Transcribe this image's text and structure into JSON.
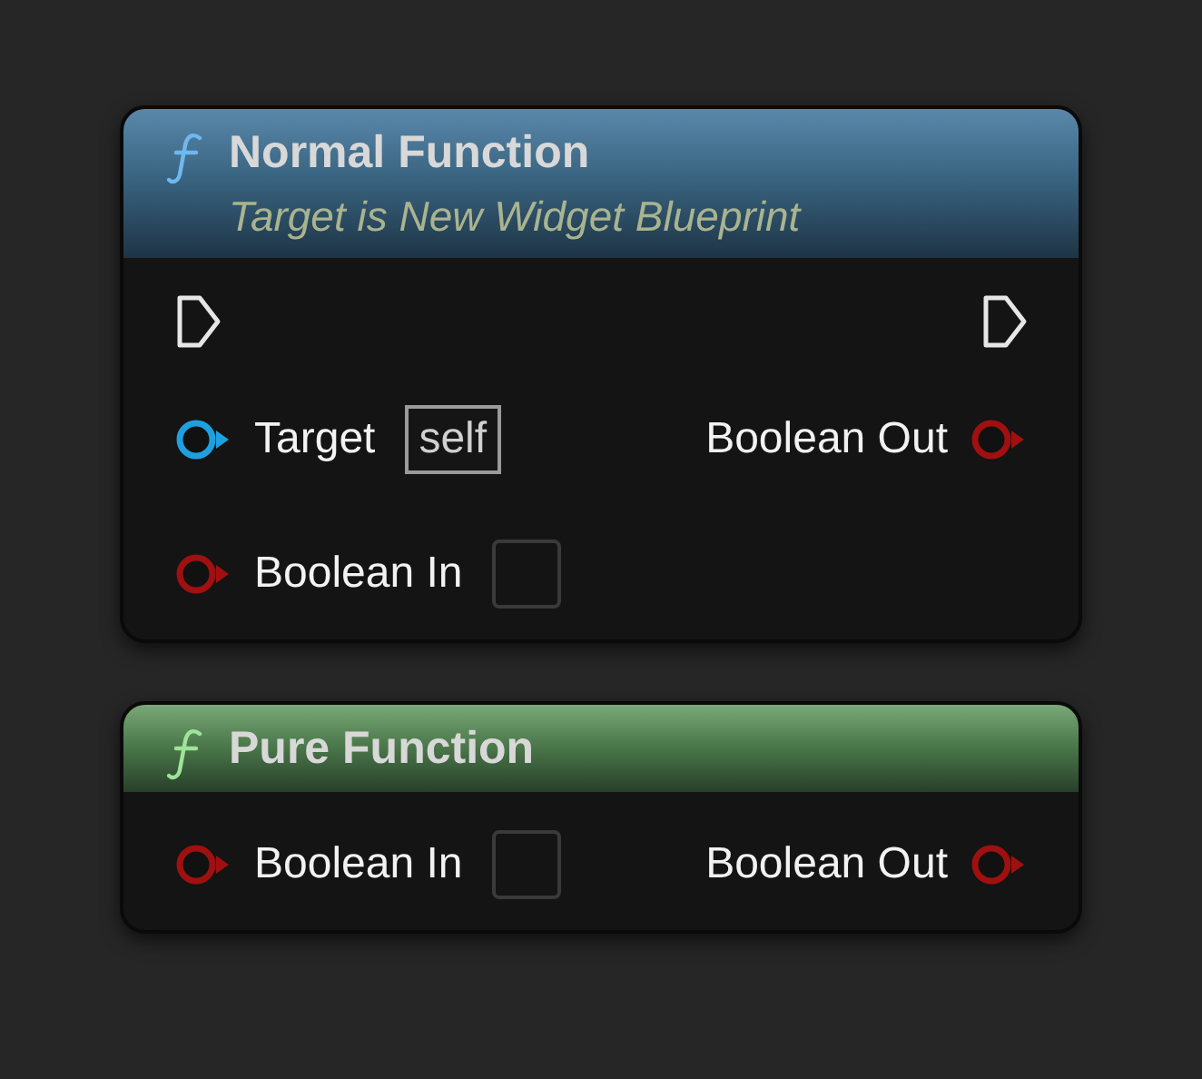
{
  "nodes": [
    {
      "kind": "normal",
      "title": "Normal Function",
      "subtitle": "Target is New Widget Blueprint",
      "exec_pins": true,
      "inputs": [
        {
          "kind": "object",
          "label": "Target",
          "value": "self"
        },
        {
          "kind": "bool",
          "label": "Boolean In",
          "checked": false
        }
      ],
      "outputs": [
        {
          "kind": "bool",
          "label": "Boolean Out"
        }
      ]
    },
    {
      "kind": "pure",
      "title": "Pure Function",
      "inputs": [
        {
          "kind": "bool",
          "label": "Boolean In",
          "checked": false
        }
      ],
      "outputs": [
        {
          "kind": "bool",
          "label": "Boolean Out"
        }
      ]
    }
  ]
}
